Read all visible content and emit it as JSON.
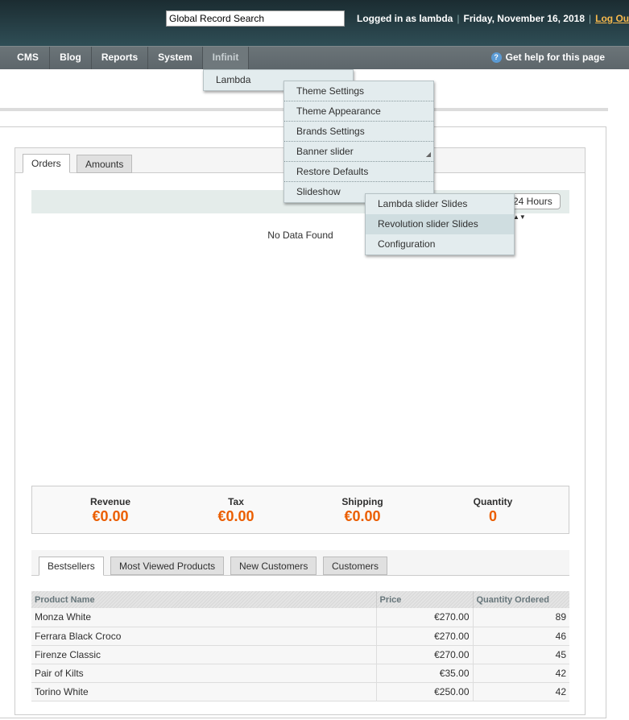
{
  "header": {
    "search_placeholder": "Global Record Search",
    "logged_in": "Logged in as lambda",
    "date": "Friday, November 16, 2018",
    "logout": "Log Out"
  },
  "nav": {
    "items": [
      "CMS",
      "Blog",
      "Reports",
      "System",
      "Infinit"
    ],
    "help": "Get help for this page"
  },
  "menus": {
    "infinit": [
      "Lambda"
    ],
    "lambda": [
      "Theme Settings",
      "Theme Appearance",
      "Brands Settings",
      "Banner slider",
      "Restore Defaults",
      "Slideshow"
    ],
    "slideshow": [
      "Lambda slider Slides",
      "Revolution slider Slides",
      "Configuration"
    ],
    "highlighted": "Revolution slider Slides"
  },
  "chart_tabs": [
    "Orders",
    "Amounts"
  ],
  "period": "24 Hours",
  "no_data": "No Data Found",
  "totals": [
    {
      "label": "Revenue",
      "value": "€0.00"
    },
    {
      "label": "Tax",
      "value": "€0.00"
    },
    {
      "label": "Shipping",
      "value": "€0.00"
    },
    {
      "label": "Quantity",
      "value": "0"
    }
  ],
  "grid_tabs": [
    "Bestsellers",
    "Most Viewed Products",
    "New Customers",
    "Customers"
  ],
  "table": {
    "headers": [
      "Product Name",
      "Price",
      "Quantity Ordered"
    ],
    "rows": [
      [
        "Monza White",
        "€270.00",
        "89"
      ],
      [
        "Ferrara Black Croco",
        "€270.00",
        "46"
      ],
      [
        "Firenze Classic",
        "€270.00",
        "45"
      ],
      [
        "Pair of Kilts",
        "€35.00",
        "42"
      ],
      [
        "Torino White",
        "€250.00",
        "42"
      ]
    ]
  },
  "colors": {
    "accent": "#eb5e00",
    "link": "#f8b94c"
  }
}
